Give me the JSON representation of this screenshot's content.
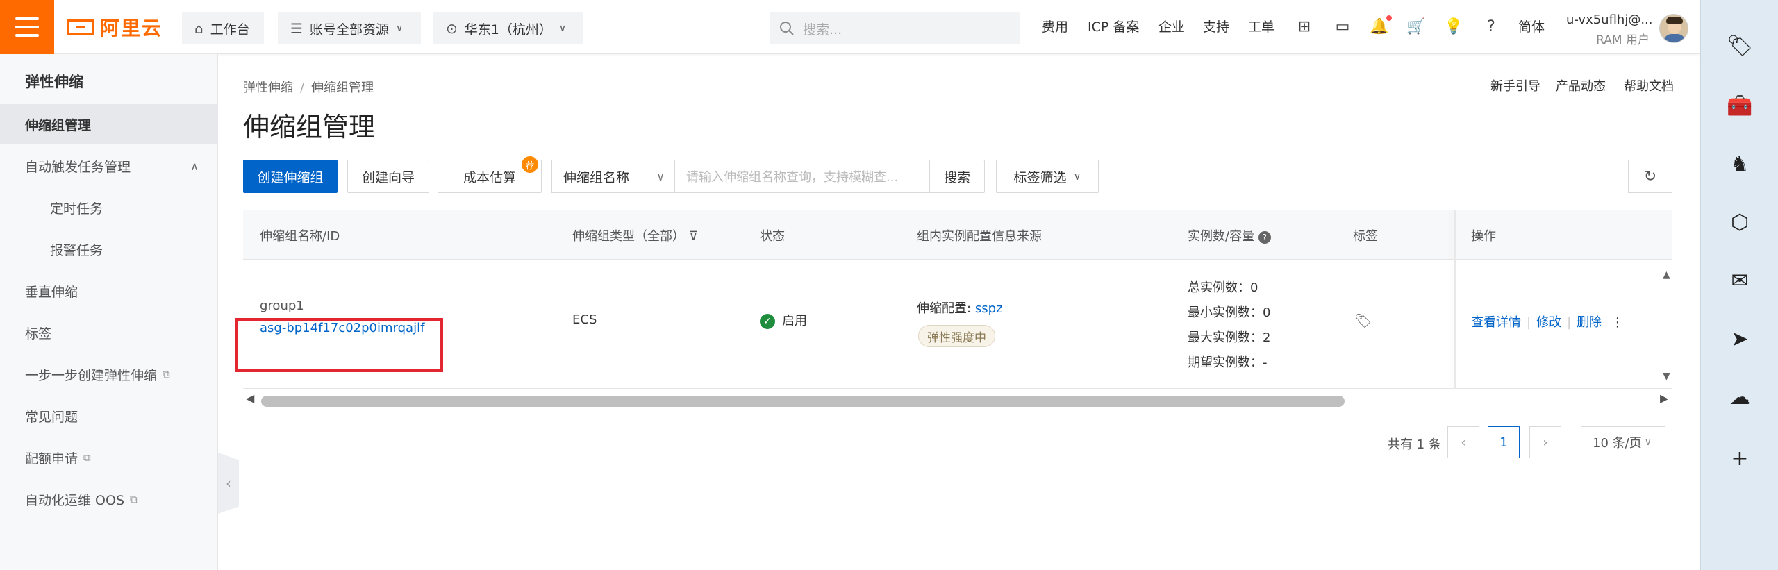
{
  "topbar": {
    "brand": "阿里云",
    "workbench": "工作台",
    "resources": "账号全部资源",
    "region": "华东1（杭州）",
    "search_placeholder": "搜索...",
    "links": [
      "费用",
      "ICP 备案",
      "企业",
      "支持",
      "工单"
    ],
    "language": "简体",
    "account_name": "u-vx5uflhj@...",
    "account_type": "RAM 用户"
  },
  "sidebar": {
    "title": "弹性伸缩",
    "items": [
      {
        "label": "伸缩组管理"
      },
      {
        "label": "自动触发任务管理"
      },
      {
        "label": "定时任务"
      },
      {
        "label": "报警任务"
      },
      {
        "label": "垂直伸缩"
      },
      {
        "label": "标签"
      },
      {
        "label": "一步一步创建弹性伸缩"
      },
      {
        "label": "常见问题"
      },
      {
        "label": "配额申请"
      },
      {
        "label": "自动化运维 OOS"
      }
    ]
  },
  "main": {
    "breadcrumb": [
      "弹性伸缩",
      "伸缩组管理"
    ],
    "help_links": [
      "新手引导",
      "产品动态",
      "帮助文档"
    ],
    "title": "伸缩组管理",
    "toolbar": {
      "create": "创建伸缩组",
      "wizard": "创建向导",
      "cost": "成本估算",
      "cost_badge": "荐",
      "filter_field": "伸缩组名称",
      "search_placeholder": "请输入伸缩组名称查询，支持模糊查...",
      "search": "搜索",
      "tag_filter": "标签筛选"
    },
    "table": {
      "columns": [
        "伸缩组名称/ID",
        "伸缩组类型（全部）",
        "状态",
        "组内实例配置信息来源",
        "实例数/容量",
        "标签",
        "操作"
      ],
      "row": {
        "name": "group1",
        "id": "asg-bp14f17c02p0imrqajlf",
        "type": "ECS",
        "status": "启用",
        "config_label": "伸缩配置:",
        "config_value": "sspz",
        "strength": "弹性强度中",
        "total": "总实例数：0",
        "min": "最小实例数：0",
        "max": "最大实例数：2",
        "expected": "期望实例数：-",
        "actions": [
          "查看详情",
          "修改",
          "删除"
        ]
      }
    },
    "pagination": {
      "total": "共有 1 条",
      "current": "1",
      "page_size": "10 条/页"
    }
  },
  "colors": {
    "brand": "#ff6a00",
    "primary": "#0064c8",
    "success": "#1e8e3e",
    "highlight": "#e3262f"
  }
}
